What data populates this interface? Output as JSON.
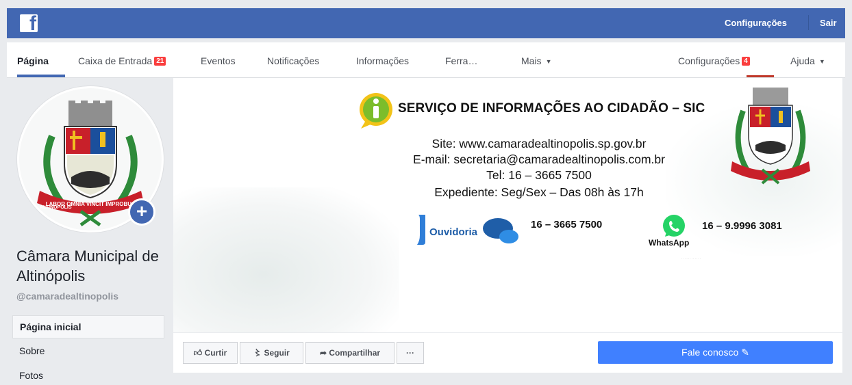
{
  "topbar": {
    "logo_letter": "f",
    "links": [
      "Configurações",
      "Sair"
    ],
    "color": "#4267b2"
  },
  "subnav": {
    "items": [
      "Página",
      "Caixa de Entrada",
      "Eventos",
      "Notificações",
      "Informações",
      "Ferra…",
      "Mais",
      "Configurações",
      "Ajuda"
    ],
    "inbox_badge": "21",
    "settings_badge": "4"
  },
  "profile": {
    "name": "Câmara Municipal de Altinópolis",
    "handle": "@camaradealtinopolis",
    "add_icon": "+"
  },
  "sidebar": {
    "items": [
      "Página inicial",
      "Sobre",
      "Fotos"
    ]
  },
  "cover": {
    "title": "SERVIÇO DE INFORMAÇÕES AO CIDADÃO – SIC",
    "site": "Site: www.camaradealtinopolis.sp.gov.br",
    "email": "E-mail: secretaria@camaradealtinopolis.com.br",
    "tel": "Tel: 16 – 3665 7500",
    "hours": "Expediente: Seg/Sex – Das 08h às 17h",
    "ouvidoria_label": "Ouvidoria",
    "ouvidoria_phone": "16 – 3665 7500",
    "whatsapp_label": "WhatsApp",
    "whatsapp_phone": "16 – 9.9996 3081",
    "crest_motto": "LABOR OMNIA VINCIT IMPROBUS",
    "crest_city": "ALTINÓPOLIS"
  },
  "actions": {
    "like": "Curtir",
    "follow": "Seguir",
    "share": "Compartilhar",
    "more": "···",
    "contact": "Fale conosco"
  },
  "icons": {
    "like": "thumbs-up-icon",
    "follow": "rss-icon",
    "share": "share-arrow-icon",
    "edit": "pencil-icon",
    "info": "info-icon",
    "chat": "chat-bubbles-icon",
    "whatsapp": "whatsapp-icon"
  }
}
